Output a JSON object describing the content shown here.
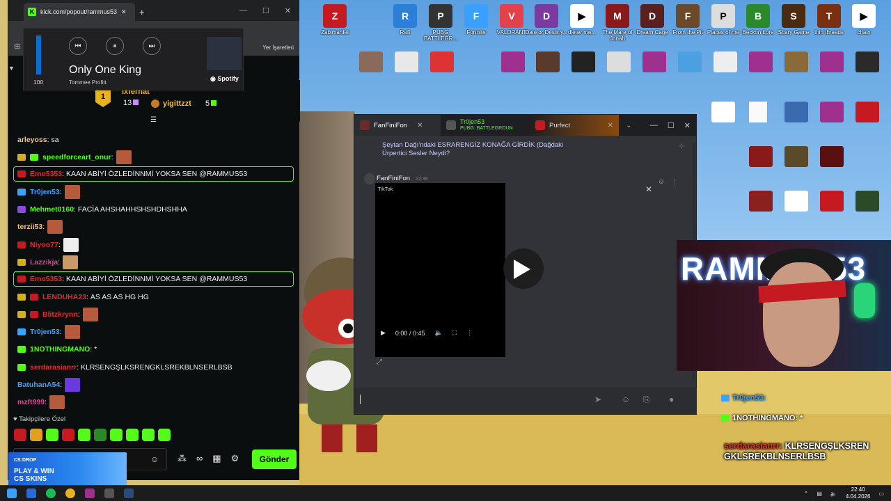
{
  "browser": {
    "tab_title": "kick.com/popout/rammus53/chat",
    "new_tab": "+",
    "bookmarks_text": "Yer İşaretleri"
  },
  "media": {
    "volume": 100,
    "volume_label": "100",
    "song": "Only One King",
    "artist": "Tommee Profitt",
    "provider": "Spotify"
  },
  "leaderboard": {
    "rank": "1",
    "user1": "ixferhat",
    "count1": "13",
    "user2": "yigittzzt",
    "count2": "5"
  },
  "chat": {
    "messages": [
      {
        "user": "arleyoss",
        "text": "sa",
        "color": "#f3c08a",
        "highlight": false,
        "emote": false
      },
      {
        "user": "speedforceart_onur",
        "text": "",
        "color": "#53fc18",
        "highlight": false,
        "emote": true
      },
      {
        "user": "Emo5353",
        "text": "KAAN ABİYİ ÖZLEDİNNMİ YOKSA SEN @RAMMUS53",
        "color": "#e02f2f",
        "highlight": true,
        "emote": false
      },
      {
        "user": "Tr0jen53",
        "text": "",
        "color": "#38a4ff",
        "highlight": false,
        "emote": true
      },
      {
        "user": "Mehmet0160",
        "text": "FACİA AHSHAHHSHSHDHSHHA",
        "color": "#53fc18",
        "highlight": false,
        "emote": false
      },
      {
        "user": "terzii53",
        "text": "",
        "color": "#f3c08a",
        "highlight": false,
        "emote": true
      },
      {
        "user": "Niyoo77",
        "text": "",
        "color": "#e02f2f",
        "highlight": false,
        "emote": true
      },
      {
        "user": "Lazzikja",
        "text": "",
        "color": "#e0419b",
        "highlight": false,
        "emote": true
      },
      {
        "user": "Emo5353",
        "text": "KAAN ABİYİ ÖZLEDİNNMİ YOKSA SEN @RAMMUS53",
        "color": "#e02f2f",
        "highlight": true,
        "emote": false
      },
      {
        "user": "LENDUHA23",
        "text": "AS AS AS HG HG",
        "color": "#e02f2f",
        "highlight": false,
        "emote": false
      },
      {
        "user": "Blitzkrynn",
        "text": "",
        "color": "#e02f2f",
        "highlight": false,
        "emote": true
      },
      {
        "user": "Tr0jen53",
        "text": "",
        "color": "#38a4ff",
        "highlight": false,
        "emote": true
      },
      {
        "user": "1NOTHINGMANO",
        "text": "*",
        "color": "#53fc18",
        "highlight": false,
        "emote": false
      },
      {
        "user": "serdarasianrr",
        "text": "KLRSENGŞLKSRENGKLSREKBLNSERLBSB",
        "color": "#e02f2f",
        "highlight": false,
        "emote": false
      },
      {
        "user": "BatuhanA54",
        "text": "",
        "color": "#38a4ff",
        "highlight": false,
        "emote": true
      },
      {
        "user": "mzft999",
        "text": "",
        "color": "#e0419b",
        "highlight": false,
        "emote": true
      }
    ],
    "followers_only": "Takipçilere Özel",
    "send_label": "Gönder",
    "ad_line1": "CS:DROP",
    "ad_line2": "PLAY & WIN",
    "ad_line3": "CS SKINS"
  },
  "discord": {
    "tabs": [
      "FanFiniFon",
      "Tr0jen53",
      "Purfect"
    ],
    "tab2_sub": "PUBG: BATTLEGROUNDS",
    "msg_text": "Şeytan Dağı'ndaki ESRARENGİZ KONAĞA GİRDİK (Dağdaki Ürpertici Sesler Neydi?",
    "author": "FanFiniFon",
    "time": "22:39",
    "tiktok": "TikTok",
    "video_time": "0:00 / 0:45"
  },
  "webcam": {
    "title": "RAMMUS53"
  },
  "overlay_chat": {
    "rows": [
      "Tr0jen53:",
      "1NOTHINGMANO: *"
    ],
    "big_user": "serdarasianrr:",
    "big_text": "KLRSENGŞLKSREN GKLSREKBLNSERLBSB"
  },
  "taskbar": {
    "time": "22:40",
    "date": "4.04.2026"
  },
  "desktop_icons": [
    {
      "label": "Zabimahfel",
      "color": "#c51a21"
    },
    {
      "label": "Raft",
      "color": "#2b7fd6"
    },
    {
      "label": "PUBG BATTLEGR...",
      "color": "#333"
    },
    {
      "label": "Fortnite",
      "color": "#3aa0ff"
    },
    {
      "label": "VALORANT",
      "color": "#e3424d"
    },
    {
      "label": "Dale or Destiny...",
      "color": "#7a3aa0"
    },
    {
      "label": "dieter me...",
      "color": "#fff"
    },
    {
      "label": "The Mare of Jonah",
      "color": "#8a1a1a"
    },
    {
      "label": "Dream Cage",
      "color": "#5a2020"
    },
    {
      "label": "From the Pit",
      "color": "#6a4a2a"
    },
    {
      "label": "Places of me",
      "color": "#ddd"
    },
    {
      "label": "Beckon Lore",
      "color": "#2a8a2a"
    },
    {
      "label": "Scary Game",
      "color": "#4a2a10"
    },
    {
      "label": "thin threads",
      "color": "#7a3010"
    },
    {
      "label": "chain",
      "color": "#fff"
    }
  ]
}
